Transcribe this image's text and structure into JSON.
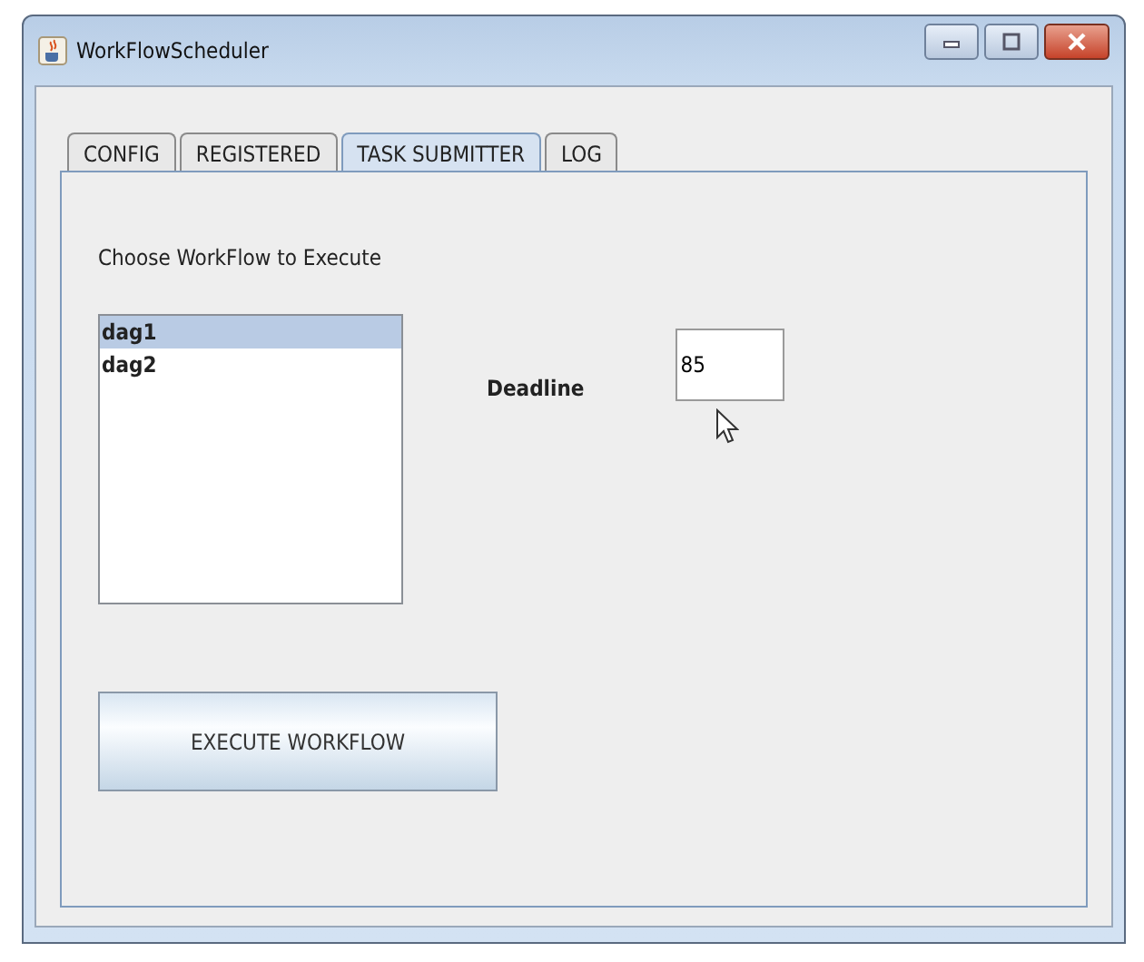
{
  "window": {
    "title": "WorkFlowScheduler"
  },
  "tabs": [
    {
      "label": "CONFIG",
      "selected": false
    },
    {
      "label": "REGISTERED",
      "selected": false
    },
    {
      "label": "TASK SUBMITTER",
      "selected": true
    },
    {
      "label": "LOG",
      "selected": false
    }
  ],
  "prompt": "Choose WorkFlow to Execute",
  "workflows": [
    {
      "label": "dag1",
      "selected": true
    },
    {
      "label": "dag2",
      "selected": false
    }
  ],
  "deadline": {
    "label": "Deadline",
    "value": "85"
  },
  "execute_button": "EXECUTE WORKFLOW"
}
